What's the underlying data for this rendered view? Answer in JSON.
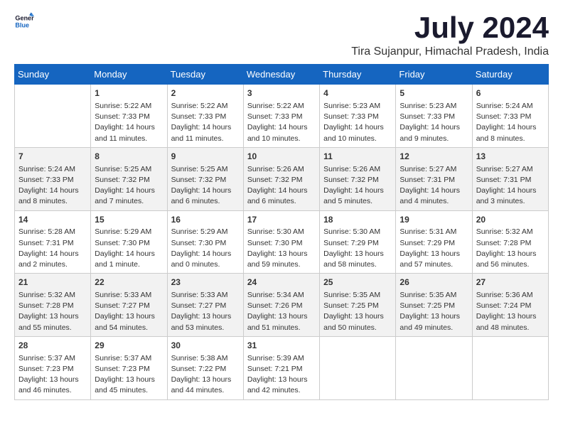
{
  "logo": {
    "text1": "General",
    "text2": "Blue"
  },
  "title": "July 2024",
  "location": "Tira Sujanpur, Himachal Pradesh, India",
  "weekdays": [
    "Sunday",
    "Monday",
    "Tuesday",
    "Wednesday",
    "Thursday",
    "Friday",
    "Saturday"
  ],
  "weeks": [
    [
      {
        "day": "",
        "info": ""
      },
      {
        "day": "1",
        "info": "Sunrise: 5:22 AM\nSunset: 7:33 PM\nDaylight: 14 hours\nand 11 minutes."
      },
      {
        "day": "2",
        "info": "Sunrise: 5:22 AM\nSunset: 7:33 PM\nDaylight: 14 hours\nand 11 minutes."
      },
      {
        "day": "3",
        "info": "Sunrise: 5:22 AM\nSunset: 7:33 PM\nDaylight: 14 hours\nand 10 minutes."
      },
      {
        "day": "4",
        "info": "Sunrise: 5:23 AM\nSunset: 7:33 PM\nDaylight: 14 hours\nand 10 minutes."
      },
      {
        "day": "5",
        "info": "Sunrise: 5:23 AM\nSunset: 7:33 PM\nDaylight: 14 hours\nand 9 minutes."
      },
      {
        "day": "6",
        "info": "Sunrise: 5:24 AM\nSunset: 7:33 PM\nDaylight: 14 hours\nand 8 minutes."
      }
    ],
    [
      {
        "day": "7",
        "info": "Sunrise: 5:24 AM\nSunset: 7:33 PM\nDaylight: 14 hours\nand 8 minutes."
      },
      {
        "day": "8",
        "info": "Sunrise: 5:25 AM\nSunset: 7:32 PM\nDaylight: 14 hours\nand 7 minutes."
      },
      {
        "day": "9",
        "info": "Sunrise: 5:25 AM\nSunset: 7:32 PM\nDaylight: 14 hours\nand 6 minutes."
      },
      {
        "day": "10",
        "info": "Sunrise: 5:26 AM\nSunset: 7:32 PM\nDaylight: 14 hours\nand 6 minutes."
      },
      {
        "day": "11",
        "info": "Sunrise: 5:26 AM\nSunset: 7:32 PM\nDaylight: 14 hours\nand 5 minutes."
      },
      {
        "day": "12",
        "info": "Sunrise: 5:27 AM\nSunset: 7:31 PM\nDaylight: 14 hours\nand 4 minutes."
      },
      {
        "day": "13",
        "info": "Sunrise: 5:27 AM\nSunset: 7:31 PM\nDaylight: 14 hours\nand 3 minutes."
      }
    ],
    [
      {
        "day": "14",
        "info": "Sunrise: 5:28 AM\nSunset: 7:31 PM\nDaylight: 14 hours\nand 2 minutes."
      },
      {
        "day": "15",
        "info": "Sunrise: 5:29 AM\nSunset: 7:30 PM\nDaylight: 14 hours\nand 1 minute."
      },
      {
        "day": "16",
        "info": "Sunrise: 5:29 AM\nSunset: 7:30 PM\nDaylight: 14 hours\nand 0 minutes."
      },
      {
        "day": "17",
        "info": "Sunrise: 5:30 AM\nSunset: 7:30 PM\nDaylight: 13 hours\nand 59 minutes."
      },
      {
        "day": "18",
        "info": "Sunrise: 5:30 AM\nSunset: 7:29 PM\nDaylight: 13 hours\nand 58 minutes."
      },
      {
        "day": "19",
        "info": "Sunrise: 5:31 AM\nSunset: 7:29 PM\nDaylight: 13 hours\nand 57 minutes."
      },
      {
        "day": "20",
        "info": "Sunrise: 5:32 AM\nSunset: 7:28 PM\nDaylight: 13 hours\nand 56 minutes."
      }
    ],
    [
      {
        "day": "21",
        "info": "Sunrise: 5:32 AM\nSunset: 7:28 PM\nDaylight: 13 hours\nand 55 minutes."
      },
      {
        "day": "22",
        "info": "Sunrise: 5:33 AM\nSunset: 7:27 PM\nDaylight: 13 hours\nand 54 minutes."
      },
      {
        "day": "23",
        "info": "Sunrise: 5:33 AM\nSunset: 7:27 PM\nDaylight: 13 hours\nand 53 minutes."
      },
      {
        "day": "24",
        "info": "Sunrise: 5:34 AM\nSunset: 7:26 PM\nDaylight: 13 hours\nand 51 minutes."
      },
      {
        "day": "25",
        "info": "Sunrise: 5:35 AM\nSunset: 7:25 PM\nDaylight: 13 hours\nand 50 minutes."
      },
      {
        "day": "26",
        "info": "Sunrise: 5:35 AM\nSunset: 7:25 PM\nDaylight: 13 hours\nand 49 minutes."
      },
      {
        "day": "27",
        "info": "Sunrise: 5:36 AM\nSunset: 7:24 PM\nDaylight: 13 hours\nand 48 minutes."
      }
    ],
    [
      {
        "day": "28",
        "info": "Sunrise: 5:37 AM\nSunset: 7:23 PM\nDaylight: 13 hours\nand 46 minutes."
      },
      {
        "day": "29",
        "info": "Sunrise: 5:37 AM\nSunset: 7:23 PM\nDaylight: 13 hours\nand 45 minutes."
      },
      {
        "day": "30",
        "info": "Sunrise: 5:38 AM\nSunset: 7:22 PM\nDaylight: 13 hours\nand 44 minutes."
      },
      {
        "day": "31",
        "info": "Sunrise: 5:39 AM\nSunset: 7:21 PM\nDaylight: 13 hours\nand 42 minutes."
      },
      {
        "day": "",
        "info": ""
      },
      {
        "day": "",
        "info": ""
      },
      {
        "day": "",
        "info": ""
      }
    ]
  ]
}
